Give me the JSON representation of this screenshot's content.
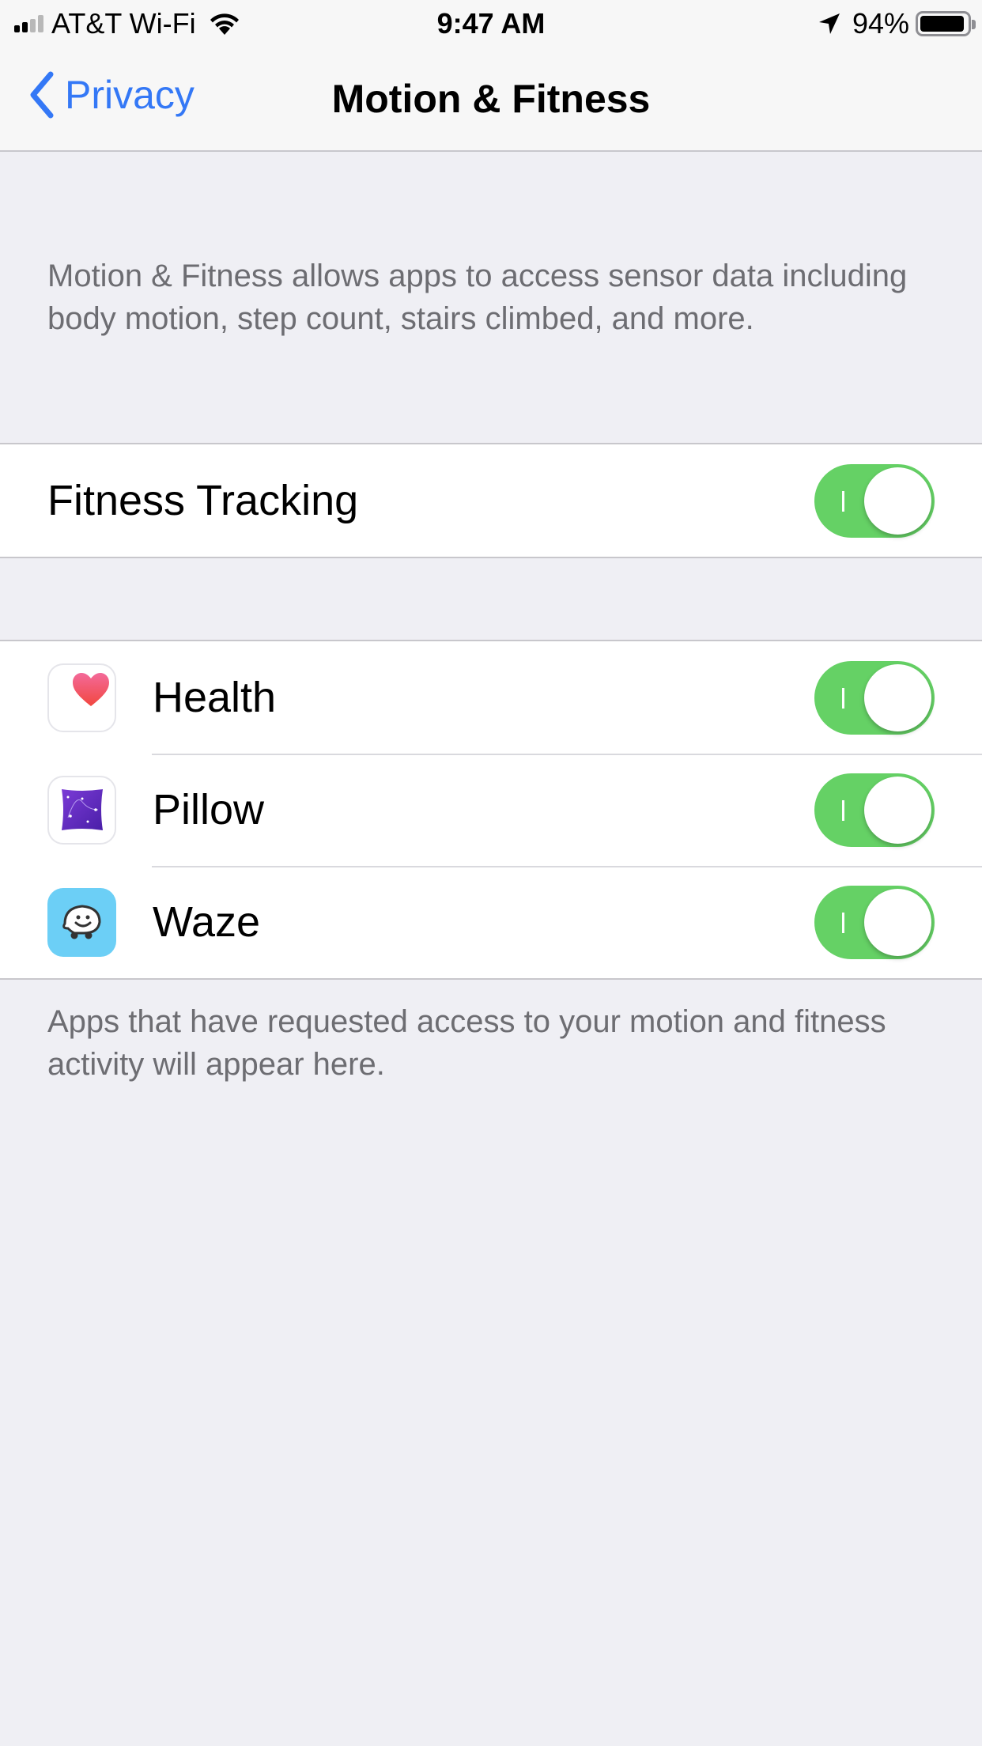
{
  "status_bar": {
    "carrier": "AT&T Wi-Fi",
    "time": "9:47 AM",
    "battery_percent": "94%",
    "battery_level": 0.94,
    "signal_bars_on": 2,
    "signal_bars_total": 4
  },
  "nav": {
    "back_label": "Privacy",
    "title": "Motion & Fitness"
  },
  "description": "Motion & Fitness allows apps to access sensor data including body motion, step count, stairs climbed, and more.",
  "fitness_tracking": {
    "label": "Fitness Tracking",
    "enabled": true
  },
  "apps": [
    {
      "name": "Health",
      "icon": "health-heart-icon",
      "enabled": true
    },
    {
      "name": "Pillow",
      "icon": "pillow-icon",
      "enabled": true
    },
    {
      "name": "Waze",
      "icon": "waze-icon",
      "enabled": true
    }
  ],
  "footer": "Apps that have requested access to your motion and fitness activity will appear here.",
  "colors": {
    "accent": "#3478f6",
    "toggle_on": "#65d165",
    "background": "#efeff4",
    "secondary_text": "#6d6d72"
  }
}
